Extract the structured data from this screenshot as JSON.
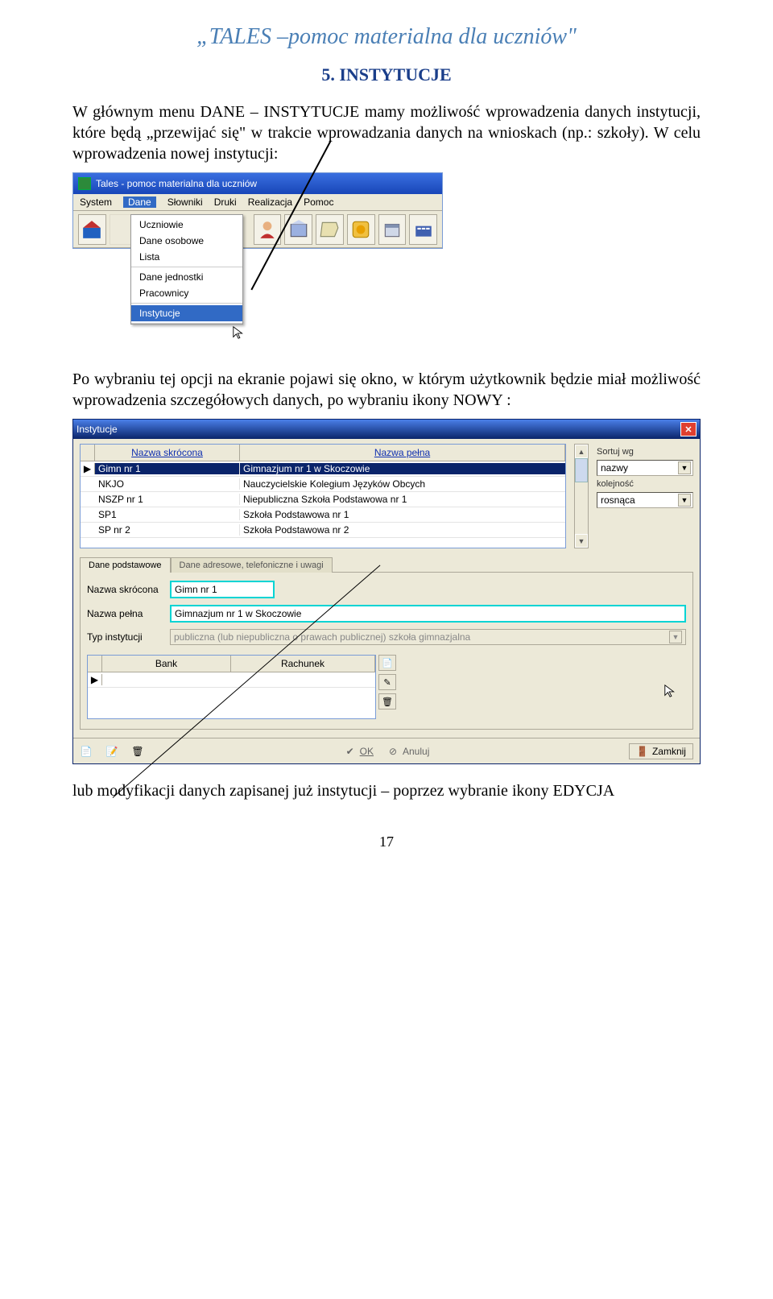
{
  "doc": {
    "header": "„TALES –pomoc materialna dla uczniów\"",
    "section_title": "5. INSTYTUCJE",
    "para1": "W głównym menu DANE – INSTYTUCJE mamy możliwość wprowadzenia danych instytucji, które będą „przewijać się\" w trakcie wprowadzania danych na wnioskach (np.: szkoły). W celu wprowadzenia nowej instytucji:",
    "para2": "Po wybraniu tej opcji na ekranie pojawi się okno, w którym użytkownik będzie miał możliwość wprowadzenia szczegółowych danych, po wybraniu ikony NOWY :",
    "para3": "lub modyfikacji danych zapisanej już instytucji – poprzez wybranie ikony EDYCJA",
    "page_number": "17"
  },
  "win1": {
    "title": "Tales - pomoc materialna dla uczniów",
    "menus": [
      "System",
      "Dane",
      "Słowniki",
      "Druki",
      "Realizacja",
      "Pomoc"
    ],
    "open_menu_index": 1,
    "dropdown": {
      "groups": [
        [
          "Uczniowie",
          "Dane osobowe",
          "Lista"
        ],
        [
          "Dane jednostki",
          "Pracownicy"
        ],
        [
          "Instytucje"
        ]
      ],
      "selected": "Instytucje"
    }
  },
  "win2": {
    "title": "Instytucje",
    "grid": {
      "headers": [
        "Nazwa skrócona",
        "Nazwa pełna"
      ],
      "rows": [
        {
          "a": "Gimn nr 1",
          "b": "Gimnazjum nr 1 w Skoczowie",
          "selected": true
        },
        {
          "a": "NKJO",
          "b": "Nauczycielskie Kolegium Języków Obcych"
        },
        {
          "a": "NSZP nr 1",
          "b": "Niepubliczna Szkoła Podstawowa nr 1"
        },
        {
          "a": "SP1",
          "b": "Szkoła Podstawowa nr 1"
        },
        {
          "a": "SP nr 2",
          "b": "Szkoła Podstawowa nr 2"
        }
      ]
    },
    "sort": {
      "label1": "Sortuj wg",
      "val1": "nazwy",
      "label2": "kolejność",
      "val2": "rosnąca"
    },
    "tabs": [
      "Dane podstawowe",
      "Dane adresowe, telefoniczne i uwagi"
    ],
    "form": {
      "shortname_label": "Nazwa skrócona",
      "shortname_val": "Gimn nr 1",
      "fullname_label": "Nazwa pełna",
      "fullname_val": "Gimnazjum nr 1 w Skoczowie",
      "type_label": "Typ instytucji",
      "type_val": "publiczna (lub niepubliczna o prawach publicznej) szkoła gimnazjalna"
    },
    "bank_headers": [
      "Bank",
      "Rachunek"
    ],
    "footer": {
      "ok": "OK",
      "cancel": "Anuluj",
      "close": "Zamknij"
    }
  }
}
